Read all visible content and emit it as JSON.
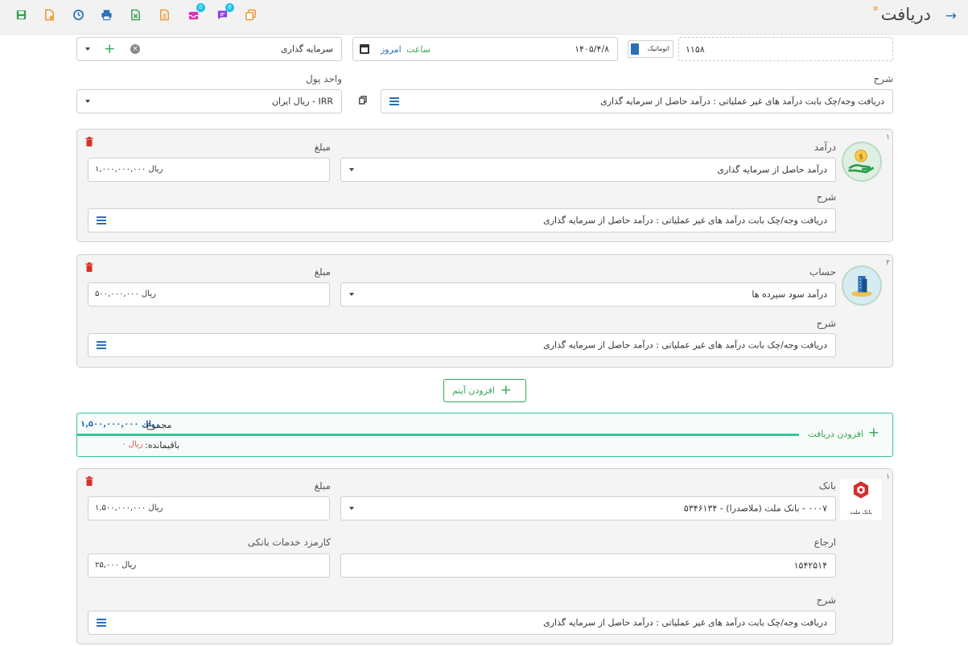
{
  "header": {
    "title": "دریافت",
    "star": "*",
    "badge_count_1": "0",
    "badge_count_2": "0"
  },
  "top_row": {
    "doc_number": "۱۱۵۸",
    "auto_label": "اتوماتیک",
    "date": "۱۴۰۵/۴/۸",
    "time_label": "ساعت",
    "today_label": "امروز",
    "project_value": "سرمایه گذاری"
  },
  "description_row": {
    "description_label": "شرح",
    "description_value": "دریافت وجه/چک بابت درآمد های غیر عملیاتی : درآمد حاصل از سرمایه گذاری",
    "currency_label": "واحد پول",
    "currency_value": "IRR - ریال ایران"
  },
  "items": [
    {
      "index": "۱",
      "type_label": "درآمد",
      "amount_label": "مبلغ",
      "account_value": "درآمد حاصل از سرمایه گذاری",
      "amount_value": "ریال ۱,۰۰۰,۰۰۰,۰۰۰",
      "desc_label": "شرح",
      "desc_value": "دریافت وجه/چک بابت درآمد های غیر عملیاتی : درآمد حاصل از سرمایه گذاری"
    },
    {
      "index": "۲",
      "type_label": "حساب",
      "amount_label": "مبلغ",
      "account_value": "درآمد سود سپرده ها",
      "amount_value": "ریال ۵۰۰,۰۰۰,۰۰۰",
      "desc_label": "شرح",
      "desc_value": "دریافت وجه/چک بابت درآمد های غیر عملیاتی : درآمد حاصل از سرمایه گذاری"
    }
  ],
  "add_item_label": "افزودن آیتم",
  "totals": {
    "add_receipt_label": "افزودن دریافت",
    "sum_label": "مجموع:",
    "sum_value": "ریال ۱,۵۰۰,۰۰۰,۰۰۰",
    "remaining_label": "باقیمانده:",
    "remaining_value": "ریال ۰"
  },
  "bank_card": {
    "index": "۱",
    "bank_label": "بانک",
    "amount_label": "مبلغ",
    "bank_value": "۰۰۰۷ - بانک ملت (ملاصدرا) - ۵۳۴۶۱۳۴",
    "logo_text": "بانک ملت",
    "amount_value": "ریال ۱,۵۰۰,۰۰۰,۰۰۰",
    "ref_label": "ارجاع",
    "ref_value": "۱۵۴۲۵۱۴",
    "fee_label": "کارمزد خدمات بانکی",
    "fee_value": "ریال ۲۵,۰۰۰",
    "desc_label": "شرح",
    "desc_value": "دریافت وجه/چک بابت درآمد های غیر عملیاتی : درآمد حاصل از سرمایه گذاری"
  },
  "colors": {
    "accent_blue": "#2a6fb8",
    "accent_green": "#34a853",
    "delete_red": "#d93025",
    "remaining_red": "#e0524a"
  }
}
